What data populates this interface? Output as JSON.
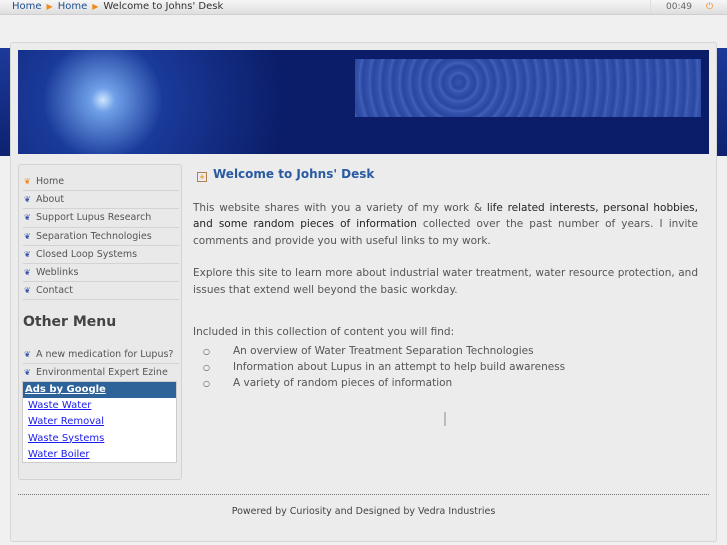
{
  "breadcrumb": {
    "items": [
      "Home",
      "Home"
    ],
    "current": "Welcome to Johns' Desk"
  },
  "clock": "00:49",
  "sidebar": {
    "nav": [
      "Home",
      "About",
      "Support Lupus Research",
      "Separation Technologies",
      "Closed Loop Systems",
      "Weblinks",
      "Contact"
    ],
    "other_title": "Other Menu",
    "other": [
      "A new medication for Lupus?",
      "Environmental Expert Ezine"
    ],
    "ads_title": "Ads by Google",
    "ads": [
      "Waste Water",
      "Water Removal",
      "Waste Systems",
      "Water Boiler"
    ]
  },
  "content": {
    "title": "Welcome to Johns' Desk",
    "p1_a": "This website shares with you a variety of my work & ",
    "p1_b": "life related interests, personal hobbies, and some random pieces of information",
    "p1_c": " collected over the past number of years. I invite comments and provide you with useful links to my work.",
    "p2": "Explore this site to learn more about industrial water treatment, water resource protection, and issues that extend well beyond the basic workday.",
    "p3": "Included in this collection of content you will find:",
    "list": [
      "An overview of Water Treatment Separation Technologies",
      "Information about Lupus in an attempt to help build awareness",
      "A variety of random pieces of information"
    ]
  },
  "footer": "Powered by Curiosity and Designed by Vedra Industries"
}
